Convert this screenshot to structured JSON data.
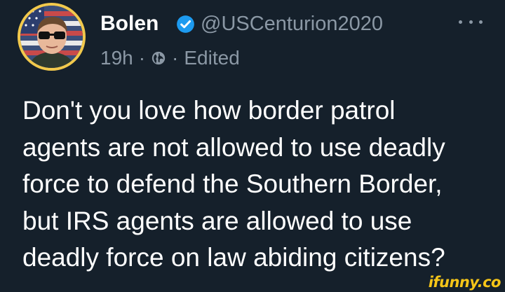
{
  "post": {
    "author_name": "Bolen",
    "handle": "@USCenturion2020",
    "time": "19h",
    "separator": "·",
    "edited_label": "Edited",
    "text": "Don't you love how border patrol\nagents are not allowed to use deadly\nforce to defend the Southern Border,\nbut IRS agents are allowed to use\ndeadly force on law abiding citizens?"
  },
  "icons": {
    "verified": "verified-badge-icon",
    "visibility": "globe-icon",
    "more": "more-options-icon"
  },
  "colors": {
    "background": "#15202b",
    "text": "#ffffff",
    "secondary_text": "#8b98a5",
    "verified": "#1d9bf0",
    "avatar_ring": "#f2c94c",
    "watermark": "#f5c518"
  },
  "watermark": {
    "text": "ifunny.co"
  }
}
